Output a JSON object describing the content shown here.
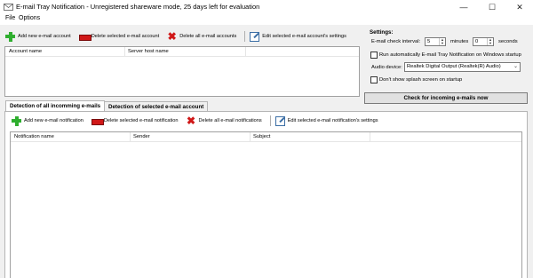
{
  "window": {
    "title": "E-mail Tray Notification - Unregistered shareware mode, 25 days left for evaluation",
    "minimize": "—",
    "maximize": "☐",
    "close": "✕"
  },
  "menu": {
    "file": "File",
    "options": "Options"
  },
  "accounts_toolbar": {
    "add": "Add new e-mail account",
    "delete_selected": "Delete selected e-mail account",
    "delete_all": "Delete all e-mail accounts",
    "edit": "Edit selected e-mail account's settings"
  },
  "accounts_list": {
    "columns": [
      "Account name",
      "Server host name"
    ]
  },
  "settings": {
    "heading": "Settings:",
    "interval_label": "E-mail check interval:",
    "interval_minutes": "5",
    "minutes_label": "minutes",
    "interval_seconds": "0",
    "seconds_label": "seconds",
    "run_startup": "Run automatically E-mail Tray Notification on Windows startup",
    "audio_label": "Audio device:",
    "audio_device": "Realtek Digital Output (Realtek(R) Audio)",
    "no_splash": "Don't show splash screen on startup",
    "check_now": "Check for incoming e-mails now"
  },
  "tabs": {
    "all": "Detection of all incomming e-mails",
    "selected": "Detection of selected e-mail account"
  },
  "notifications_toolbar": {
    "add": "Add new e-mail notification",
    "delete_selected": "Delete selected e-mail notification",
    "delete_all": "Delete all e-mail notifications",
    "edit": "Edit selected e-mail notification's settings"
  },
  "notifications_list": {
    "columns": [
      "Notification name",
      "Sender",
      "Subject"
    ]
  },
  "icons": {
    "add": "plus-icon",
    "delete": "delete-bar-icon",
    "delete_all": "x-icon",
    "edit": "edit-icon"
  }
}
